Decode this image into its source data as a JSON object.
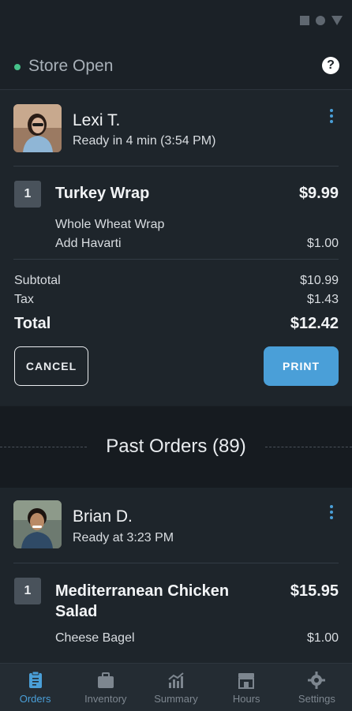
{
  "store": {
    "status": "Store Open",
    "help": "?"
  },
  "current_order": {
    "customer": "Lexi T.",
    "ready": "Ready in 4 min (3:54 PM)",
    "items": [
      {
        "qty": "1",
        "name": "Turkey Wrap",
        "price": "$9.99",
        "modifiers": [
          {
            "text": "Whole Wheat Wrap",
            "price": ""
          },
          {
            "text": "Add Havarti",
            "price": "$1.00"
          }
        ]
      }
    ],
    "subtotal_label": "Subtotal",
    "subtotal": "$10.99",
    "tax_label": "Tax",
    "tax": "$1.43",
    "total_label": "Total",
    "total": "$12.42",
    "cancel_label": "CANCEL",
    "print_label": "PRINT"
  },
  "past_orders": {
    "title": "Past Orders (89)",
    "orders": [
      {
        "customer": "Brian D.",
        "ready": "Ready at 3:23 PM",
        "items": [
          {
            "qty": "1",
            "name": "Mediterranean Chicken Salad",
            "price": "$15.95",
            "modifiers": [
              {
                "text": "Cheese Bagel",
                "price": "$1.00"
              }
            ]
          }
        ]
      }
    ]
  },
  "tabs": [
    {
      "label": "Orders",
      "icon": "clipboard-icon",
      "active": true
    },
    {
      "label": "Inventory",
      "icon": "briefcase-icon",
      "active": false
    },
    {
      "label": "Summary",
      "icon": "chart-icon",
      "active": false
    },
    {
      "label": "Hours",
      "icon": "storefront-icon",
      "active": false
    },
    {
      "label": "Settings",
      "icon": "gear-icon",
      "active": false
    }
  ],
  "colors": {
    "accent": "#4a9fd8",
    "open_status": "#46c28a",
    "background": "#1b2127"
  }
}
